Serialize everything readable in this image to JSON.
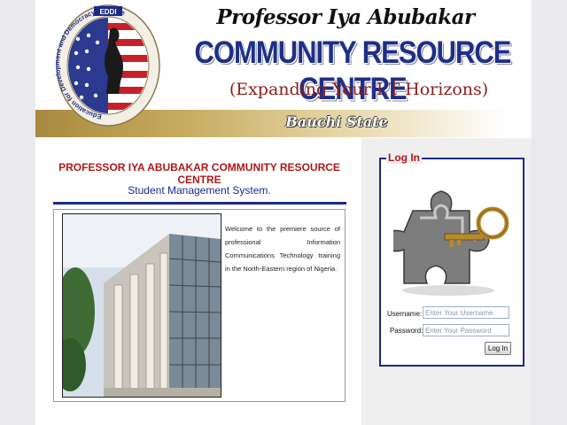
{
  "header": {
    "professor_line": "Professor Iya Abubakar",
    "centre_title": "COMMUNITY RESOURCE CENTRE",
    "tagline": "(Expanding Your I.T Horizons)",
    "state": "Bauchi State",
    "logo": {
      "acronym": "EDDI",
      "ring_text": "Education for Development and Democracy Initiative"
    }
  },
  "main": {
    "heading": "PROFESSOR IYA ABUBAKAR COMMUNITY RESOURCE CENTRE",
    "subheading": "Student Management System.",
    "welcome_text": "Welcome to the premiere source of professional Information Communications Technology training in the North-Eastern region of Nigeria."
  },
  "login": {
    "legend": "Log In",
    "username_label": "Username:",
    "username_placeholder": "Enter Your Username.",
    "username_value": "",
    "password_label": "Password:",
    "password_placeholder": "Enter Your Password",
    "password_value": "",
    "button_label": "Log In"
  },
  "colors": {
    "accent_blue": "#1b2a8a",
    "accent_red": "#b01818",
    "banner_gold": "#a88a3f"
  },
  "icons": {
    "logo": "eddi-flag-emblem",
    "login_image": "puzzle-key-icon"
  }
}
